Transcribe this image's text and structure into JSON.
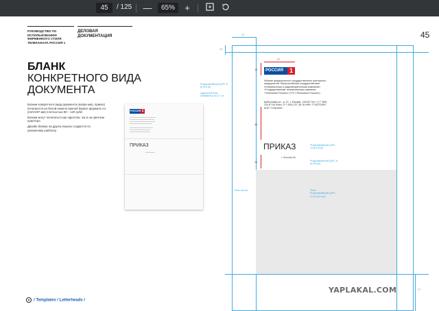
{
  "toolbar": {
    "page_current": "45",
    "page_total": "/ 125",
    "zoom_out": "—",
    "zoom_value": "65%",
    "zoom_in": "+",
    "fit_icon": "fit-page-icon",
    "rotate_icon": "rotate-icon"
  },
  "page": {
    "header_brand": "РУКОВОДСТВО ПО ИСПОЛЬЗОВАНИЮ ФИРМЕННОГО СТИЛЯ ТЕЛЕКАНАЛА РОССИЯ 1",
    "header_section_line1": "ДЕЛОВАЯ",
    "header_section_line2": "ДОКУМЕНТАЦИЯ",
    "page_number": "45",
    "title_line1": "БЛАНК",
    "title_line2": "КОНКРЕТНОГО ВИДА",
    "title_line3": "ДОКУМЕНТА",
    "desc_p1": "Бланки конкретного вида документа (напри мер, приказ) печатаются на белой немело ванной бумаге формата А4 (210×297 мм) плотностью 80 – 120 гр/м².",
    "desc_p2": "Бланки могут печататься как офсетом, так и на цветном принтере.",
    "desc_p3": "Дизайн бланка на других языках создается по указанному шаблону.",
    "thumb_logo": "РОССИЯ",
    "thumb_logo_num": "1",
    "thumb_prikaz": "ПРИКАЗ",
    "footer_nav": "/ Templates / Letterheads /"
  },
  "diagram": {
    "logo": "РОССИЯ",
    "logo_num": "1",
    "dim_27_top": "27",
    "dim_27_logo": "27",
    "dim_15_top": "15",
    "dim_13": "13",
    "dim_45": "45",
    "dim_24": "24",
    "dim_27_bottom": "27",
    "org_text": "Филиал федерального государственного унитарного предприятия «Всероссийская государственная телевизионная и радиовещательная компания» «Государственная телевизионная компания «Телеканал Россия» (ГТК «Телеканал Россия»)",
    "addr_text": "Шаболовка ул., д. 37, г. Москва, 115162 Тел.: (+7 495) 234 87 64 Факс: (+7 495) 237 38 15 ИНН 7714072839 КПП 774904001",
    "prikaz": "ПРИКАЗ",
    "moscow": "г. Москва №",
    "note_left1": "PragmaticaBookCyrPC 8 pt (9.6 pt)",
    "note_left2": "Адресный блок отбивается на 3.7 pt",
    "note_right1": "PragmaticaBookCyrPC 14 pt (16 pt)",
    "note_right2": "PragmaticaBookCyrPC 8 pt (9.6 pt)",
    "note_graybox_left": "Поле текста",
    "note_graybox_right": "Текст PragmaticaBookCyrPC 12 pt (14.4 pt)"
  },
  "watermark": "YAPLAKAL.COM",
  "colors": {
    "brand_blue": "#0a4ea2",
    "brand_red": "#d51f2b",
    "guide_blue": "#3ea9e0"
  }
}
